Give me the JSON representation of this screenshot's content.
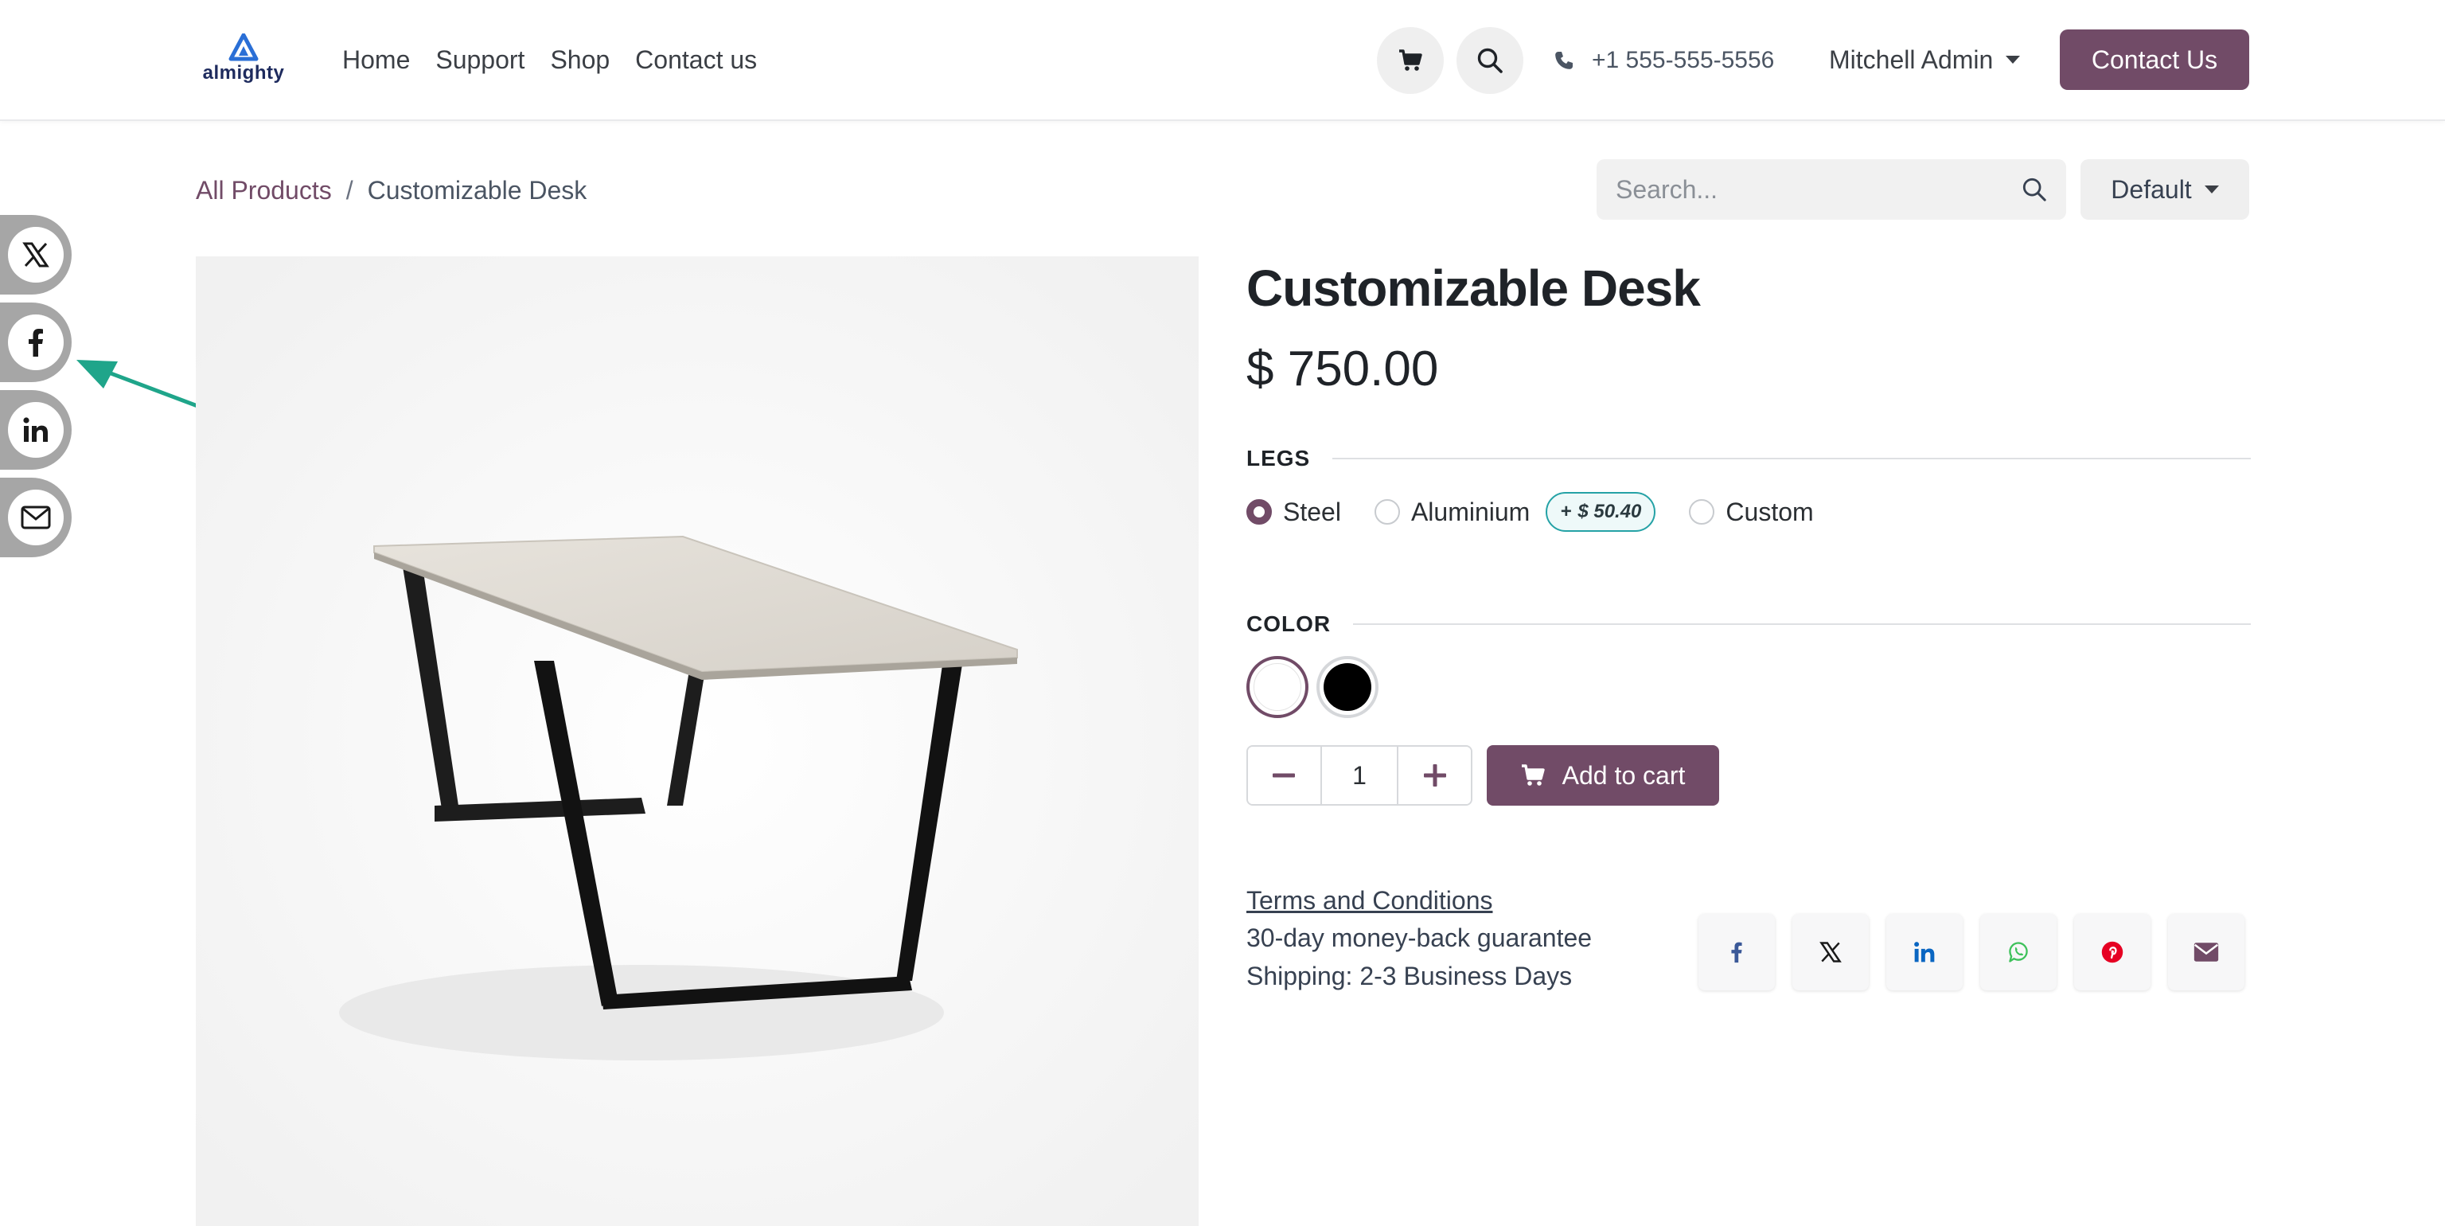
{
  "colors": {
    "brand": "#714b67",
    "extra_price_border": "#25a2a6",
    "arrow": "#1fa58a",
    "swatch_white": "#ffffff",
    "swatch_black": "#000000"
  },
  "header": {
    "logo_text": "almighty",
    "nav": [
      "Home",
      "Support",
      "Shop",
      "Contact us"
    ],
    "cart_icon": "cart-icon",
    "search_icon": "search-icon",
    "phone": "+1 555-555-5556",
    "user": "Mitchell Admin",
    "cta": "Contact Us"
  },
  "side_share": [
    "x-icon",
    "facebook-icon",
    "linkedin-icon",
    "email-icon"
  ],
  "breadcrumb": {
    "parent": "All Products",
    "separator": "/",
    "current": "Customizable Desk"
  },
  "search": {
    "placeholder": "Search..."
  },
  "sort": {
    "label": "Default"
  },
  "product": {
    "name": "Customizable Desk",
    "price": "$ 750.00",
    "legs": {
      "label": "LEGS",
      "options": [
        {
          "label": "Steel",
          "checked": true
        },
        {
          "label": "Aluminium",
          "checked": false,
          "extra_sign": "+",
          "extra": "$ 50.40"
        },
        {
          "label": "Custom",
          "checked": false
        }
      ]
    },
    "color": {
      "label": "COLOR",
      "swatches": [
        {
          "name": "white",
          "hex": "#ffffff",
          "selected": true
        },
        {
          "name": "black",
          "hex": "#000000",
          "selected": false
        }
      ]
    },
    "quantity": "1",
    "add_to_cart": "Add to cart",
    "terms": "Terms and Conditions",
    "guarantee": "30-day money-back guarantee",
    "shipping": "Shipping: 2-3 Business Days"
  },
  "share_buttons": [
    "facebook-icon",
    "x-icon",
    "linkedin-icon",
    "whatsapp-icon",
    "pinterest-icon",
    "email-icon"
  ]
}
